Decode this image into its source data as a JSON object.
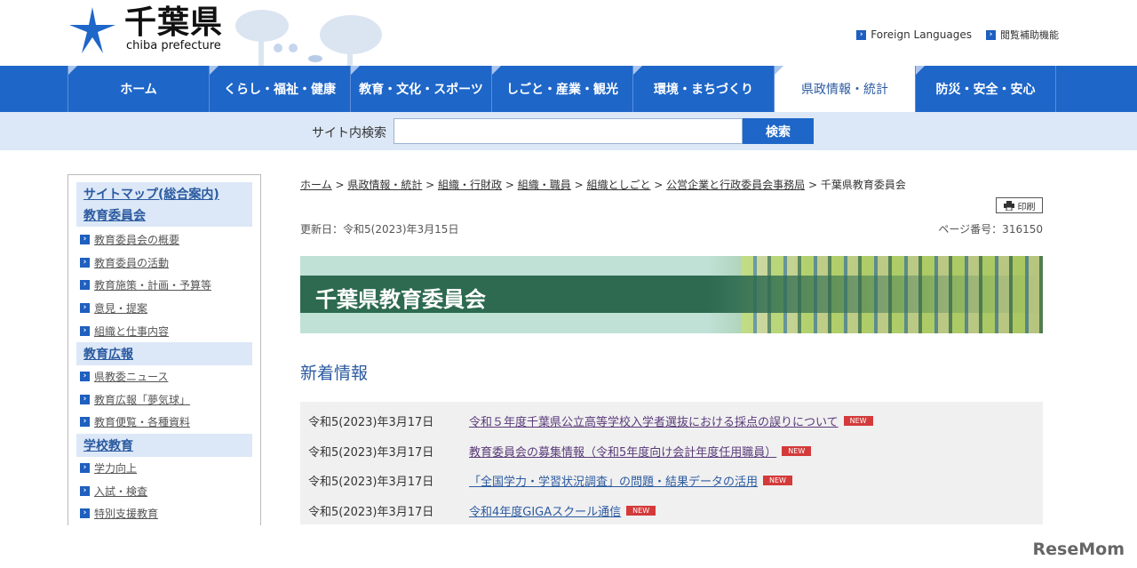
{
  "header": {
    "logo_title": "千葉県",
    "logo_sub": "chiba prefecture",
    "util": [
      "Foreign Languages",
      "閲覧補助機能"
    ]
  },
  "nav": [
    "ホーム",
    "くらし・福祉・健康",
    "教育・文化・スポーツ",
    "しごと・産業・観光",
    "環境・まちづくり",
    "県政情報・統計",
    "防災・安全・安心"
  ],
  "search": {
    "label": "サイト内検索",
    "value": "",
    "button": "検索"
  },
  "sidebar": {
    "sections": [
      {
        "title": "サイトマップ(総合案内)",
        "items": []
      },
      {
        "title": "教育委員会",
        "items": [
          "教育委員会の概要",
          "教育委員の活動",
          "教育施策・計画・予算等",
          "意見・提案",
          "組織と仕事内容"
        ]
      },
      {
        "title": "教育広報",
        "items": [
          "県教委ニュース",
          "教育広報「夢気球」",
          "教育便覧・各種資料"
        ]
      },
      {
        "title": "学校教育",
        "items": [
          "学力向上",
          "入試・検査",
          "特別支援教育"
        ]
      }
    ]
  },
  "breadcrumb": [
    "ホーム",
    "県政情報・統計",
    "組織・行財政",
    "組織・職員",
    "組織としごと",
    "公営企業と行政委員会事務局",
    "千葉県教育委員会"
  ],
  "print_label": "印刷",
  "updated": "更新日：令和5(2023)年3月15日",
  "page_number": "ページ番号：316150",
  "banner_title": "千葉県教育委員会",
  "news": {
    "heading": "新着情報",
    "badge": "NEW",
    "items": [
      {
        "date": "令和5(2023)年3月17日",
        "title": "令和５年度千葉県公立高等学校入学者選抜における採点の誤りについて"
      },
      {
        "date": "令和5(2023)年3月17日",
        "title": "教育委員会の募集情報（令和5年度向け会計年度任用職員）"
      },
      {
        "date": "令和5(2023)年3月17日",
        "title": "「全国学力・学習状況調査」の問題・結果データの活用"
      },
      {
        "date": "令和5(2023)年3月17日",
        "title": "令和4年度GIGAスクール通信"
      }
    ]
  },
  "watermark": "ReseMom"
}
